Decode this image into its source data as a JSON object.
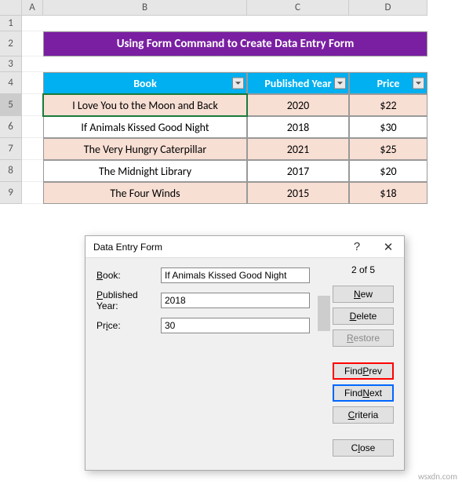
{
  "col_headers": [
    "",
    "A",
    "B",
    "C",
    "D"
  ],
  "row_headers": [
    "1",
    "2",
    "3",
    "4",
    "5",
    "6",
    "7",
    "8",
    "9"
  ],
  "title": "Using Form Command to Create Data Entry Form",
  "table": {
    "headers": [
      "Book",
      "Published Year",
      "Price"
    ],
    "rows": [
      {
        "book": "I Love You to the Moon and Back",
        "year": "2020",
        "price": "$22"
      },
      {
        "book": "If Animals Kissed Good Night",
        "year": "2018",
        "price": "$30"
      },
      {
        "book": "The Very Hungry Caterpillar",
        "year": "2021",
        "price": "$25"
      },
      {
        "book": "The Midnight Library",
        "year": "2017",
        "price": "$20"
      },
      {
        "book": "The Four Winds",
        "year": "2015",
        "price": "$18"
      }
    ]
  },
  "dialog": {
    "title": "Data Entry Form",
    "record_counter": "2 of 5",
    "fields": {
      "book_label_pre": "B",
      "book_label_post": "ook:",
      "year_label_pre": "P",
      "year_label_post": "ublished Year:",
      "price_label_pre": "Pr",
      "price_label_post": "ice:",
      "book_value": "If Animals Kissed Good Night",
      "year_value": "2018",
      "price_value": "30"
    },
    "buttons": {
      "new_pre": "",
      "new_u": "N",
      "new_post": "ew",
      "delete_pre": "",
      "delete_u": "D",
      "delete_post": "elete",
      "restore_pre": "",
      "restore_u": "R",
      "restore_post": "estore",
      "findprev_pre": "Find ",
      "findprev_u": "P",
      "findprev_post": "rev",
      "findnext_pre": "Find ",
      "findnext_u": "N",
      "findnext_post": "ext",
      "criteria_pre": "",
      "criteria_u": "C",
      "criteria_post": "riteria",
      "close_pre": "C",
      "close_u": "l",
      "close_post": "ose"
    }
  },
  "watermark": "wsxdn.com"
}
